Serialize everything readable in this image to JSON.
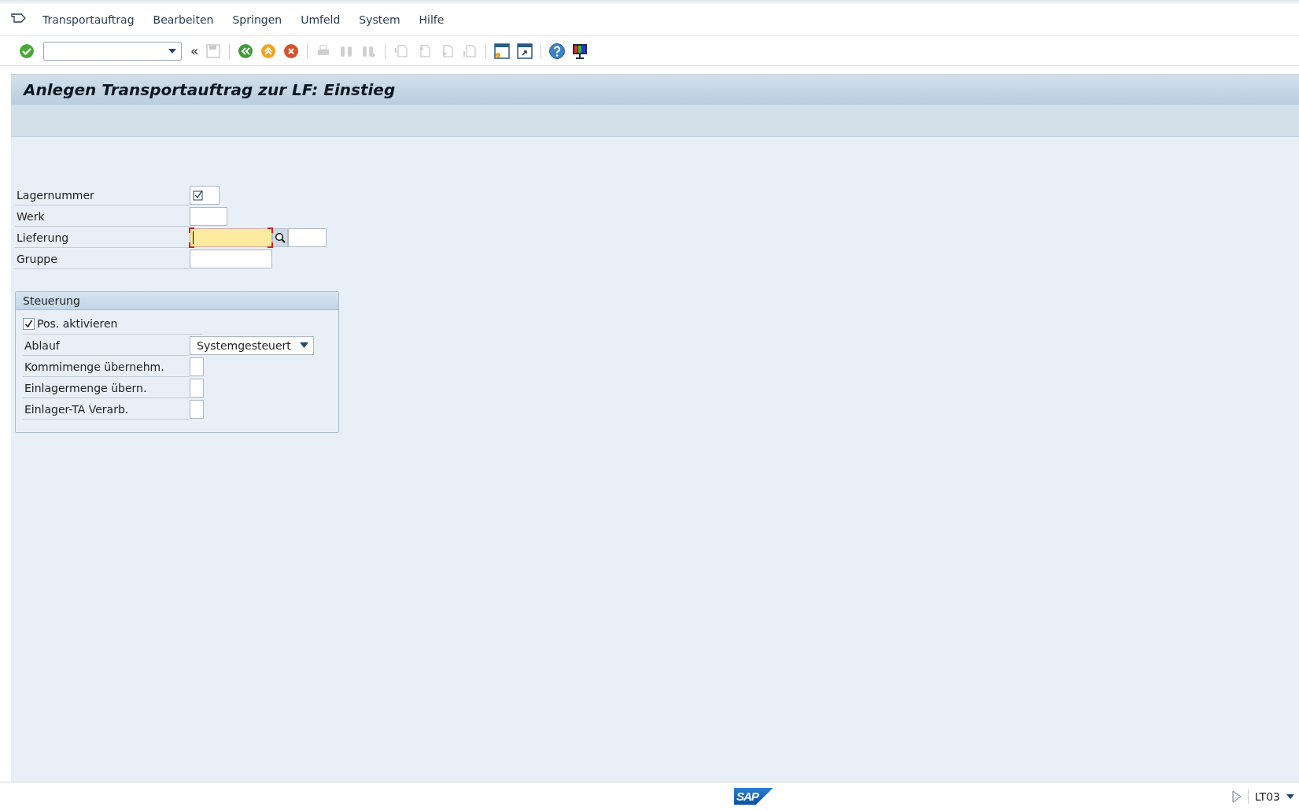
{
  "menu_bar": {
    "items": [
      {
        "label": "Transportauftrag"
      },
      {
        "label": "Bearbeiten"
      },
      {
        "label": "Springen"
      },
      {
        "label": "Umfeld"
      },
      {
        "label": "System"
      },
      {
        "label": "Hilfe"
      }
    ]
  },
  "toolbar": {
    "buttons": [
      {
        "kind": "enter",
        "disabled": false
      },
      {
        "kind": "command",
        "disabled": false
      },
      {
        "kind": "collapse",
        "label": "«",
        "disabled": false
      },
      {
        "kind": "save",
        "disabled": true
      },
      {
        "kind": "sep"
      },
      {
        "kind": "back",
        "disabled": false
      },
      {
        "kind": "exit",
        "disabled": false
      },
      {
        "kind": "cancel",
        "disabled": false
      },
      {
        "kind": "sep"
      },
      {
        "kind": "print",
        "disabled": true
      },
      {
        "kind": "find",
        "disabled": true
      },
      {
        "kind": "find_next",
        "disabled": true
      },
      {
        "kind": "sep"
      },
      {
        "kind": "first_page",
        "disabled": true
      },
      {
        "kind": "prev_page",
        "disabled": true
      },
      {
        "kind": "next_page",
        "disabled": true
      },
      {
        "kind": "last_page",
        "disabled": true
      },
      {
        "kind": "sep"
      },
      {
        "kind": "new_session",
        "disabled": false
      },
      {
        "kind": "shortcut",
        "disabled": false
      },
      {
        "kind": "sep"
      },
      {
        "kind": "help",
        "disabled": false
      },
      {
        "kind": "layout",
        "disabled": false
      }
    ]
  },
  "title": "Anlegen Transportauftrag zur LF: Einstieg",
  "fields": [
    {
      "label": "Lagernummer",
      "required": true,
      "focused": false,
      "search_help": false
    },
    {
      "label": "Werk",
      "required": false,
      "focused": false,
      "search_help": false
    },
    {
      "label": "Lieferung",
      "required": false,
      "focused": true,
      "search_help": true
    },
    {
      "label": "Gruppe",
      "required": false,
      "focused": false,
      "search_help": false
    }
  ],
  "group": {
    "title": "Steuerung",
    "items": [
      {
        "kind": "checkbox",
        "label": "Pos. aktivieren",
        "checked": true
      },
      {
        "kind": "dropdown",
        "label": "Ablauf",
        "value": "Systemgesteuert"
      },
      {
        "kind": "input",
        "label": "Kommimenge übernehm."
      },
      {
        "kind": "input",
        "label": "Einlagermenge übern."
      },
      {
        "kind": "input",
        "label": "Einlager-TA Verarb."
      }
    ]
  },
  "status_bar": {
    "logo": "SAP",
    "transaction": "LT03"
  }
}
